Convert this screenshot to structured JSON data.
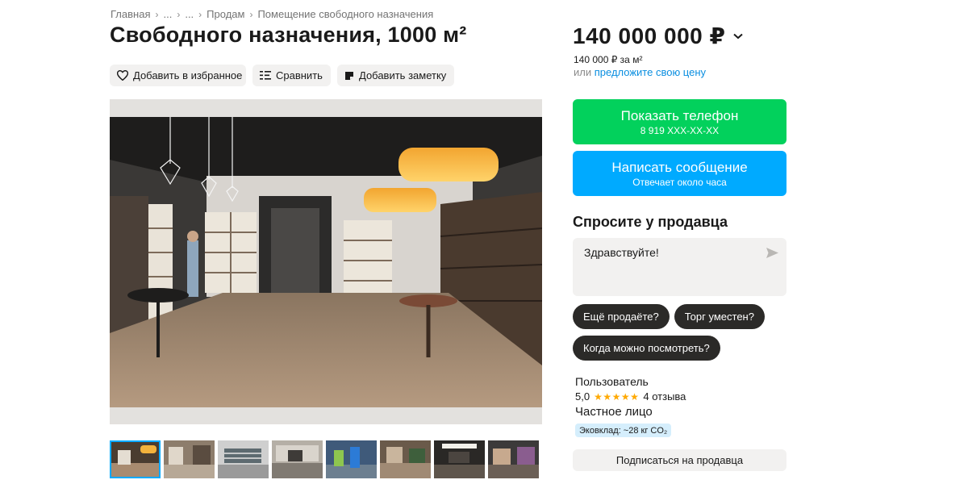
{
  "breadcrumb": {
    "items": [
      "Главная",
      "...",
      "...",
      "Продам",
      "Помещение свободного назначения"
    ]
  },
  "listing": {
    "title": "Свободного назначения, 1000 м²"
  },
  "actions": {
    "favorite": "Добавить в избранное",
    "compare": "Сравнить",
    "note": "Добавить заметку"
  },
  "gallery": {
    "thumb_count": 8,
    "active_index": 0
  },
  "price": {
    "value": "140 000 000 ₽",
    "per_sqm": "140 000 ₽ за м²",
    "offer_prefix": "или ",
    "offer_link": "предложите свою цену"
  },
  "cta": {
    "phone_label": "Показать телефон",
    "phone_number": "8 919 XXX-XX-XX",
    "message_label": "Написать сообщение",
    "message_sub": "Отвечает около часа"
  },
  "ask": {
    "title": "Спросите у продавца",
    "value": "Здравствуйте!",
    "chips": [
      "Ещё продаёте?",
      "Торг уместен?",
      "Когда можно посмотреть?"
    ]
  },
  "seller": {
    "name": "Пользователь",
    "rating": "5,0",
    "stars": "★★★★★",
    "reviews": "4 отзыва",
    "type": "Частное лицо",
    "eco": "Эковклад: ~28 кг CO₂",
    "subscribe": "Подписаться на продавца"
  },
  "colors": {
    "phone_button": "#02d15c",
    "message_button": "#00aaff",
    "link": "#0a8ee0",
    "chip": "#2b2a28",
    "star": "#ffa901",
    "eco_badge": "#d5eefc"
  }
}
